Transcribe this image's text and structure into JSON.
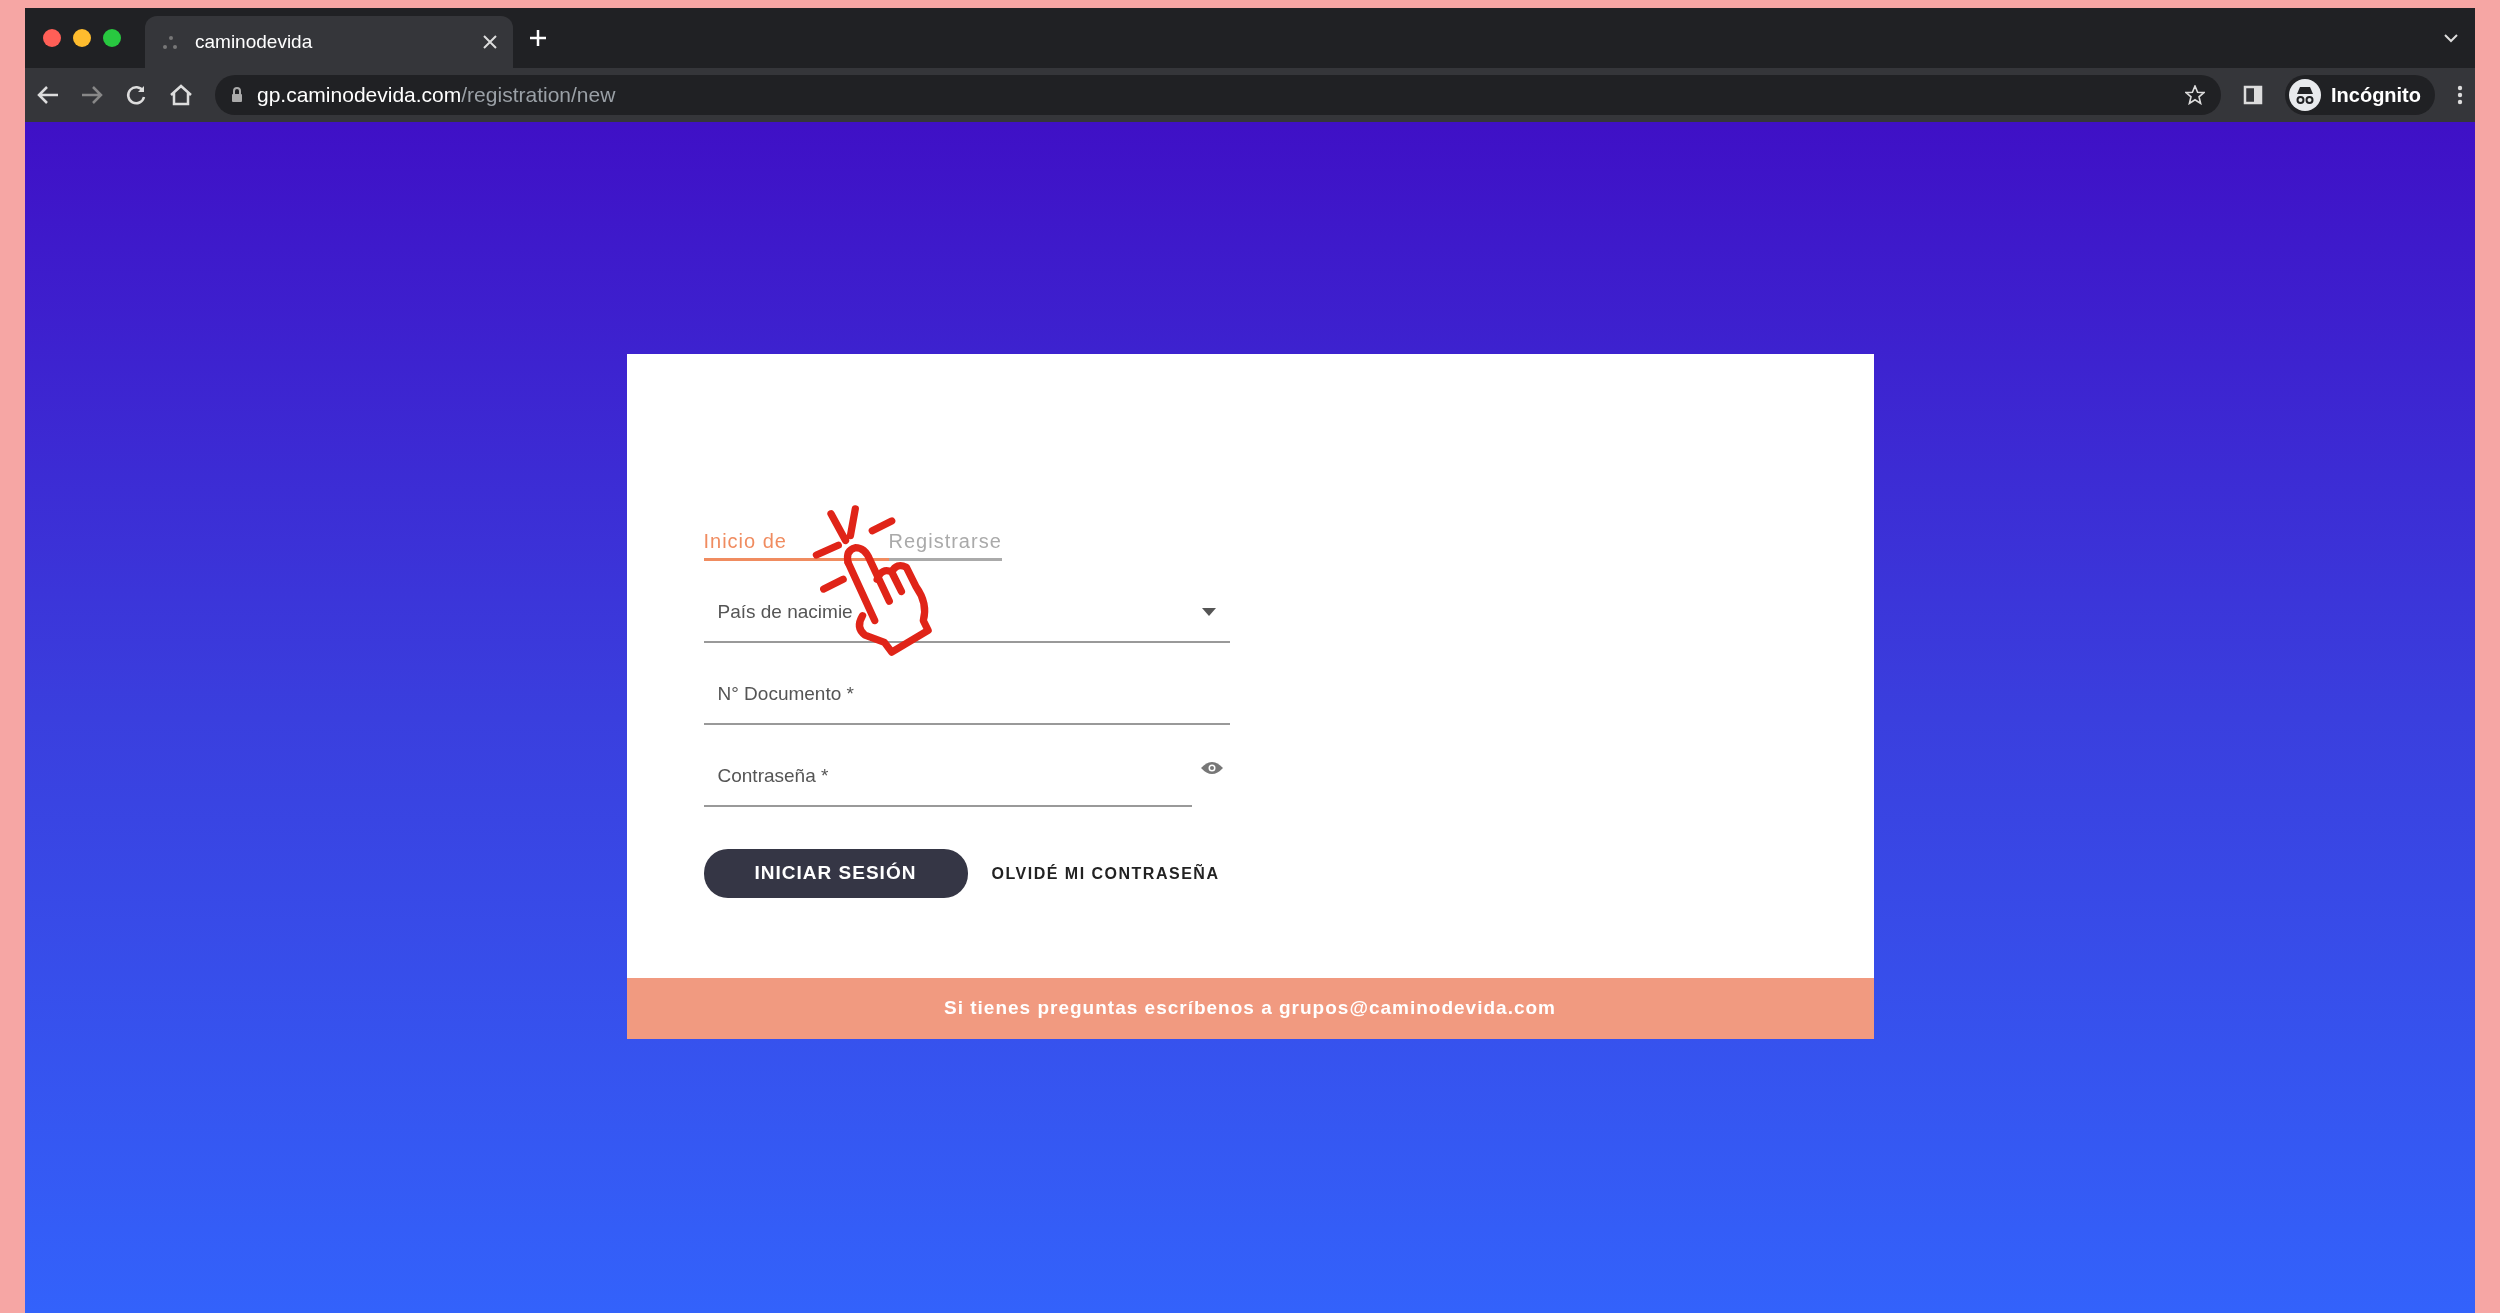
{
  "browser": {
    "tab_title": "caminodevida",
    "url_host": "gp.caminodevida.com",
    "url_path": "/registration/new",
    "profile": "Incógnito"
  },
  "tabs": [
    {
      "label": "Inicio de",
      "selected": true
    },
    {
      "label": "Registrarse",
      "selected": false
    }
  ],
  "fields": [
    {
      "kind": "select",
      "placeholder": "País de nacimie"
    },
    {
      "kind": "text",
      "placeholder": "N° Documento *"
    },
    {
      "kind": "password",
      "placeholder": "Contraseña *"
    }
  ],
  "actions": {
    "submit": "INICIAR SESIÓN",
    "forgot": "OLVIDÉ MI CONTRASEÑA"
  },
  "footer": "Si tienes preguntas escríbenos a grupos@caminodevida.com"
}
